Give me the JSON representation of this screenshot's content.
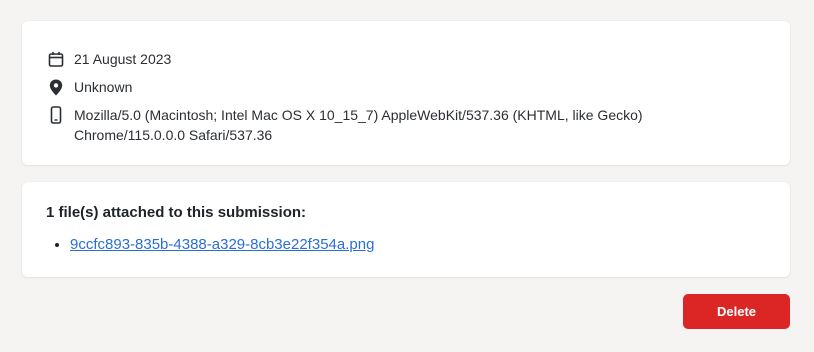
{
  "submission": {
    "date": "21 August 2023",
    "location": "Unknown",
    "user_agent": "Mozilla/5.0 (Macintosh; Intel Mac OS X 10_15_7) AppleWebKit/537.36 (KHTML, like Gecko) Chrome/115.0.0.0 Safari/537.36",
    "icons": {
      "date": "calendar-icon",
      "location": "map-pin-icon",
      "device": "mobile-phone-icon"
    }
  },
  "files": {
    "title": "1 file(s) attached to this submission:",
    "items": [
      {
        "name": "9ccfc893-835b-4388-a329-8cb3e22f354a.png"
      }
    ]
  },
  "actions": {
    "delete_label": "Delete"
  },
  "colors": {
    "delete": "#dc2626",
    "link": "#2a6fd6",
    "background": "#f5f4f2"
  }
}
